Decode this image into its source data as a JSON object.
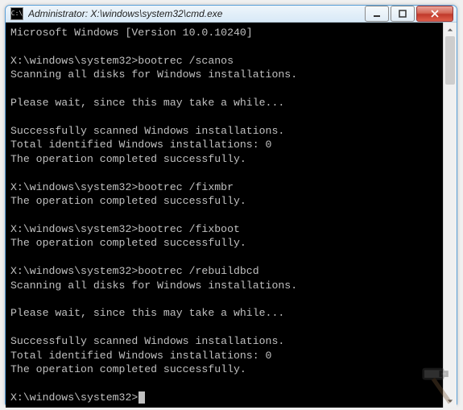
{
  "window": {
    "icon_label": "C:\\",
    "title": "Administrator: X:\\windows\\system32\\cmd.exe",
    "controls": {
      "minimize": "Minimize",
      "maximize": "Maximize",
      "close": "Close"
    }
  },
  "terminal": {
    "lines": [
      "Microsoft Windows [Version 10.0.10240]",
      "",
      "X:\\windows\\system32>bootrec /scanos",
      "Scanning all disks for Windows installations.",
      "",
      "Please wait, since this may take a while...",
      "",
      "Successfully scanned Windows installations.",
      "Total identified Windows installations: 0",
      "The operation completed successfully.",
      "",
      "X:\\windows\\system32>bootrec /fixmbr",
      "The operation completed successfully.",
      "",
      "X:\\windows\\system32>bootrec /fixboot",
      "The operation completed successfully.",
      "",
      "X:\\windows\\system32>bootrec /rebuildbcd",
      "Scanning all disks for Windows installations.",
      "",
      "Please wait, since this may take a while...",
      "",
      "Successfully scanned Windows installations.",
      "Total identified Windows installations: 0",
      "The operation completed successfully.",
      ""
    ],
    "prompt": "X:\\windows\\system32>"
  }
}
